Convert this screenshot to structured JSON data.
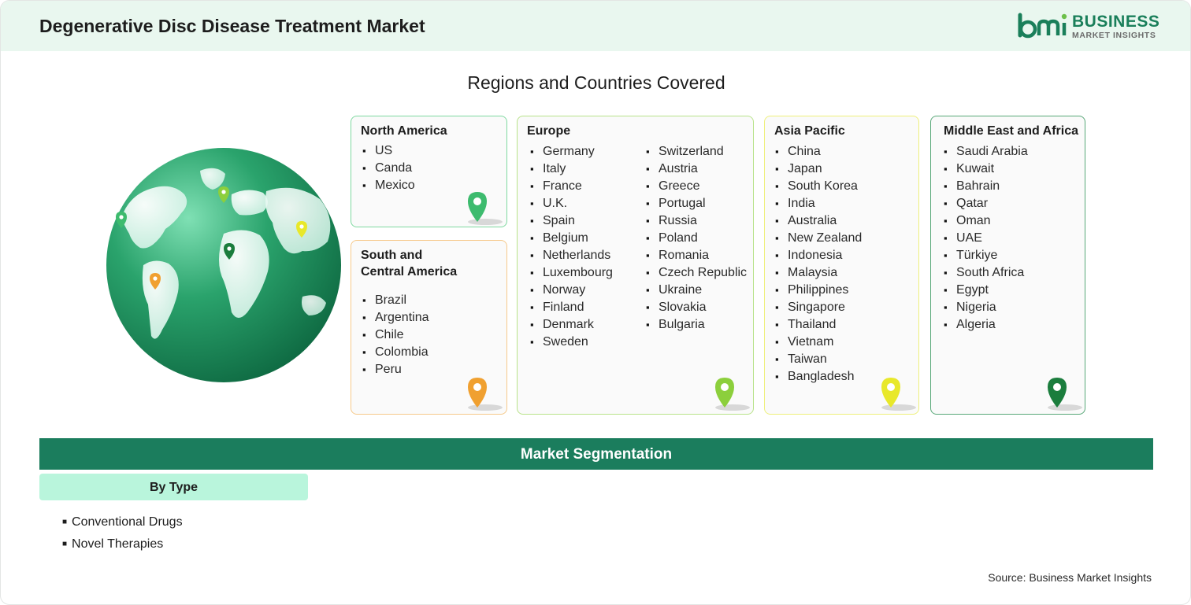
{
  "header": {
    "title": "Degenerative Disc Disease Treatment Market",
    "logo_line1": "BUSINESS",
    "logo_line2": "MARKET INSIGHTS"
  },
  "regions_title": "Regions and Countries Covered",
  "regions": {
    "north_america": {
      "title": "North America",
      "countries": [
        "US",
        "Canda",
        "Mexico"
      ],
      "color": "#3dbb6e"
    },
    "south_central_america": {
      "title_line1": "South and",
      "title_line2": "Central America",
      "countries": [
        "Brazil",
        "Argentina",
        "Chile",
        "Colombia",
        "Peru"
      ],
      "color": "#f0a030"
    },
    "europe": {
      "title": "Europe",
      "countries_col1": [
        "Germany",
        "Italy",
        "France",
        "U.K.",
        "Spain",
        "Belgium",
        "Netherlands",
        "Luxembourg",
        "Norway",
        "Finland",
        "Denmark",
        "Sweden"
      ],
      "countries_col2": [
        "Switzerland",
        "Austria",
        "Greece",
        "Portugal",
        "Russia",
        "Poland",
        "Romania",
        "Czech Republic",
        "Ukraine",
        "Slovakia",
        "Bulgaria"
      ],
      "color": "#8ccf3c"
    },
    "asia_pacific": {
      "title": "Asia Pacific",
      "countries": [
        "China",
        "Japan",
        "South Korea",
        "India",
        "Australia",
        "New Zealand",
        "Indonesia",
        "Malaysia",
        "Philippines",
        "Singapore",
        "Thailand",
        "Vietnam",
        "Taiwan",
        "Bangladesh"
      ],
      "color": "#e8e82a"
    },
    "middle_east_africa": {
      "title": "Middle East and Africa",
      "countries": [
        "Saudi Arabia",
        "Kuwait",
        "Bahrain",
        "Qatar",
        "Oman",
        "UAE",
        "Türkiye",
        "South Africa",
        "Egypt",
        "Nigeria",
        "Algeria"
      ],
      "color": "#1b7d3d"
    }
  },
  "segmentation": {
    "title": "Market Segmentation",
    "by_type_label": "By Type",
    "types": [
      "Conventional Drugs",
      "Novel Therapies"
    ]
  },
  "source": "Source: Business Market Insights",
  "colors": {
    "brand_green": "#1b7d5d",
    "header_bg": "#e9f7ef",
    "pill_bg": "#b9f5dc"
  }
}
